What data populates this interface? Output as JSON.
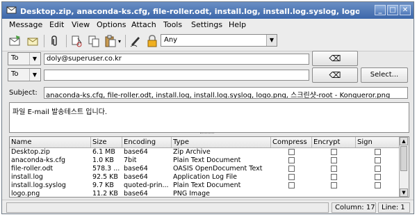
{
  "window": {
    "title": "Desktop.zip, anaconda-ks.cfg, file-roller.odt, install.log, install.log.syslog, logo.png, 스크린샷—root - Kon",
    "controls": [
      "_",
      "□",
      "✕"
    ]
  },
  "menu": [
    {
      "label": "Message"
    },
    {
      "label": "Edit"
    },
    {
      "label": "View"
    },
    {
      "label": "Options"
    },
    {
      "label": "Attach"
    },
    {
      "label": "Tools"
    },
    {
      "label": "Settings"
    },
    {
      "label": "Help"
    }
  ],
  "toolbar": {
    "identity_value": "Any",
    "icons": [
      "send-icon",
      "queue-icon",
      "attach-icon",
      "cut-icon",
      "copy-icon",
      "paste-icon",
      "sign-icon",
      "encrypt-icon"
    ]
  },
  "recipients": [
    {
      "type": "To",
      "value": "doly@superuser.co.kr"
    },
    {
      "type": "To",
      "value": ""
    }
  ],
  "select_label": "Select...",
  "subject_label": "Subject:",
  "subject_value": "anaconda-ks.cfg, file-roller.odt, install.log, install.log.syslog, logo.png, 스크린샷-root - Konqueror.png",
  "body_text": "파일 E-mail 발송테스트 입니다.",
  "attachments": {
    "headers": {
      "name": "Name",
      "size": "Size",
      "encoding": "Encoding",
      "type": "Type",
      "compress": "Compress",
      "encrypt": "Encrypt",
      "sign": "Sign"
    },
    "rows": [
      {
        "name": "Desktop.zip",
        "size": "6.1 MB",
        "encoding": "base64",
        "type": "Zip Archive"
      },
      {
        "name": "anaconda-ks.cfg",
        "size": "1.0 KB",
        "encoding": "7bit",
        "type": "Plain Text Document"
      },
      {
        "name": "file-roller.odt",
        "size": "578.3 ...",
        "encoding": "base64",
        "type": "OASIS OpenDocument Text"
      },
      {
        "name": "install.log",
        "size": "92.5 KB",
        "encoding": "base64",
        "type": "Application Log File"
      },
      {
        "name": "install.log.syslog",
        "size": "9.7 KB",
        "encoding": "quoted-prin...",
        "type": "Plain Text Document"
      },
      {
        "name": "logo.png",
        "size": "11.2 KB",
        "encoding": "base64",
        "type": "PNG Image"
      }
    ]
  },
  "status": {
    "column": "Column:  17",
    "line": "Line:  1"
  }
}
